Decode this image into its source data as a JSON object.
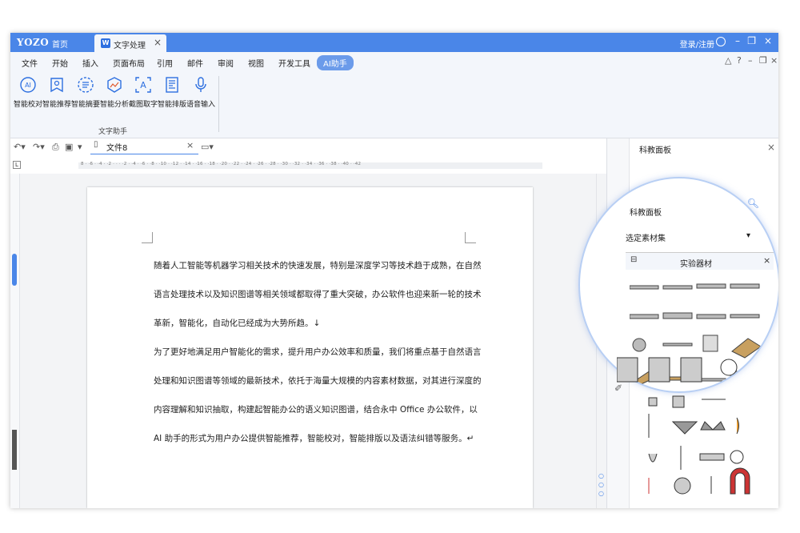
{
  "titlebar": {
    "logo": "YOZO",
    "home": "首页",
    "tab_title": "文字处理",
    "login": "登录/注册",
    "accent": "#4a86e8"
  },
  "menu": [
    "文件",
    "开始",
    "插入",
    "页面布局",
    "引用",
    "邮件",
    "审阅",
    "视图",
    "开发工具",
    "AI助手"
  ],
  "ribbon": {
    "buttons": [
      "智能校对",
      "智能推荐",
      "智能摘要",
      "智能分析",
      "截图取字",
      "智能排版",
      "语音输入"
    ],
    "group_label": "文字助手"
  },
  "doc": {
    "tab_name": "文件8",
    "ruler_marks": "8 · ·6 · ·4 · ·2 · · · ·2 · ·4 · ·6 · ·8 · ·10 · ·12 · ·14 · ·16 · ·18 · ·20 · ·22 · ·24 · ·26 · ·28 · ·30 · ·32 · ·34 · ·36 · ·38 · ·40 · ·42",
    "lines": [
      "随着人工智能等机器学习相关技术的快速发展，特别是深度学习等技术趋于成熟，在自然",
      "语言处理技术以及知识图谱等相关领域都取得了重大突破，办公软件也迎来新一轮的技术",
      "革新，智能化，自动化已经成为大势所趋。↓",
      "为了更好地满足用户智能化的需求，提升用户办公效率和质量，我们将重点基于自然语言",
      "处理和知识图谱等领域的最新技术，依托于海量大规模的内容素材数据，对其进行深度的",
      "内容理解和知识抽取，构建起智能办公的语义知识图谱，结合永中 Office 办公软件，以",
      "AI 助手的形式为用户办公提供智能推荐，智能校对，智能排版以及语法纠错等服务。↵"
    ]
  },
  "sidebar": {
    "title": "科教面板",
    "panel_title": "科教面板",
    "select_label": "选定素材集",
    "group_title": "实验器材"
  }
}
